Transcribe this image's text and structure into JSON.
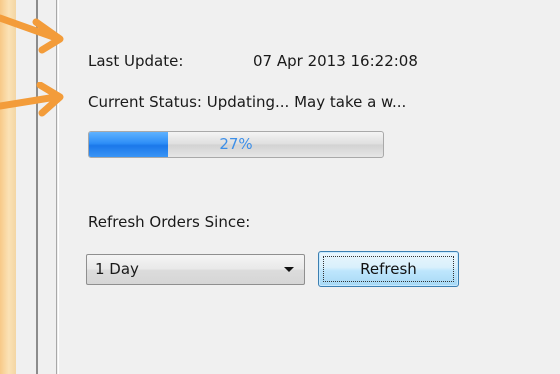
{
  "info": {
    "last_update_label": "Last Update:",
    "last_update_value": "07 Apr 2013 16:22:08",
    "current_status": "Current Status: Updating... May take a w..."
  },
  "progress": {
    "value_percent": 27,
    "label": "27%"
  },
  "refresh": {
    "since_label": "Refresh Orders Since:",
    "selected_option": "1 Day",
    "button_label": "Refresh"
  },
  "colors": {
    "annotation_arrow": "#f39c3a",
    "progress_fill": "#2e8ef7",
    "progress_text": "#3d8fe8",
    "panel_edge": "#f7c987"
  },
  "icons": {
    "annotation": "arrow-right-icon",
    "dropdown": "chevron-down-icon"
  }
}
